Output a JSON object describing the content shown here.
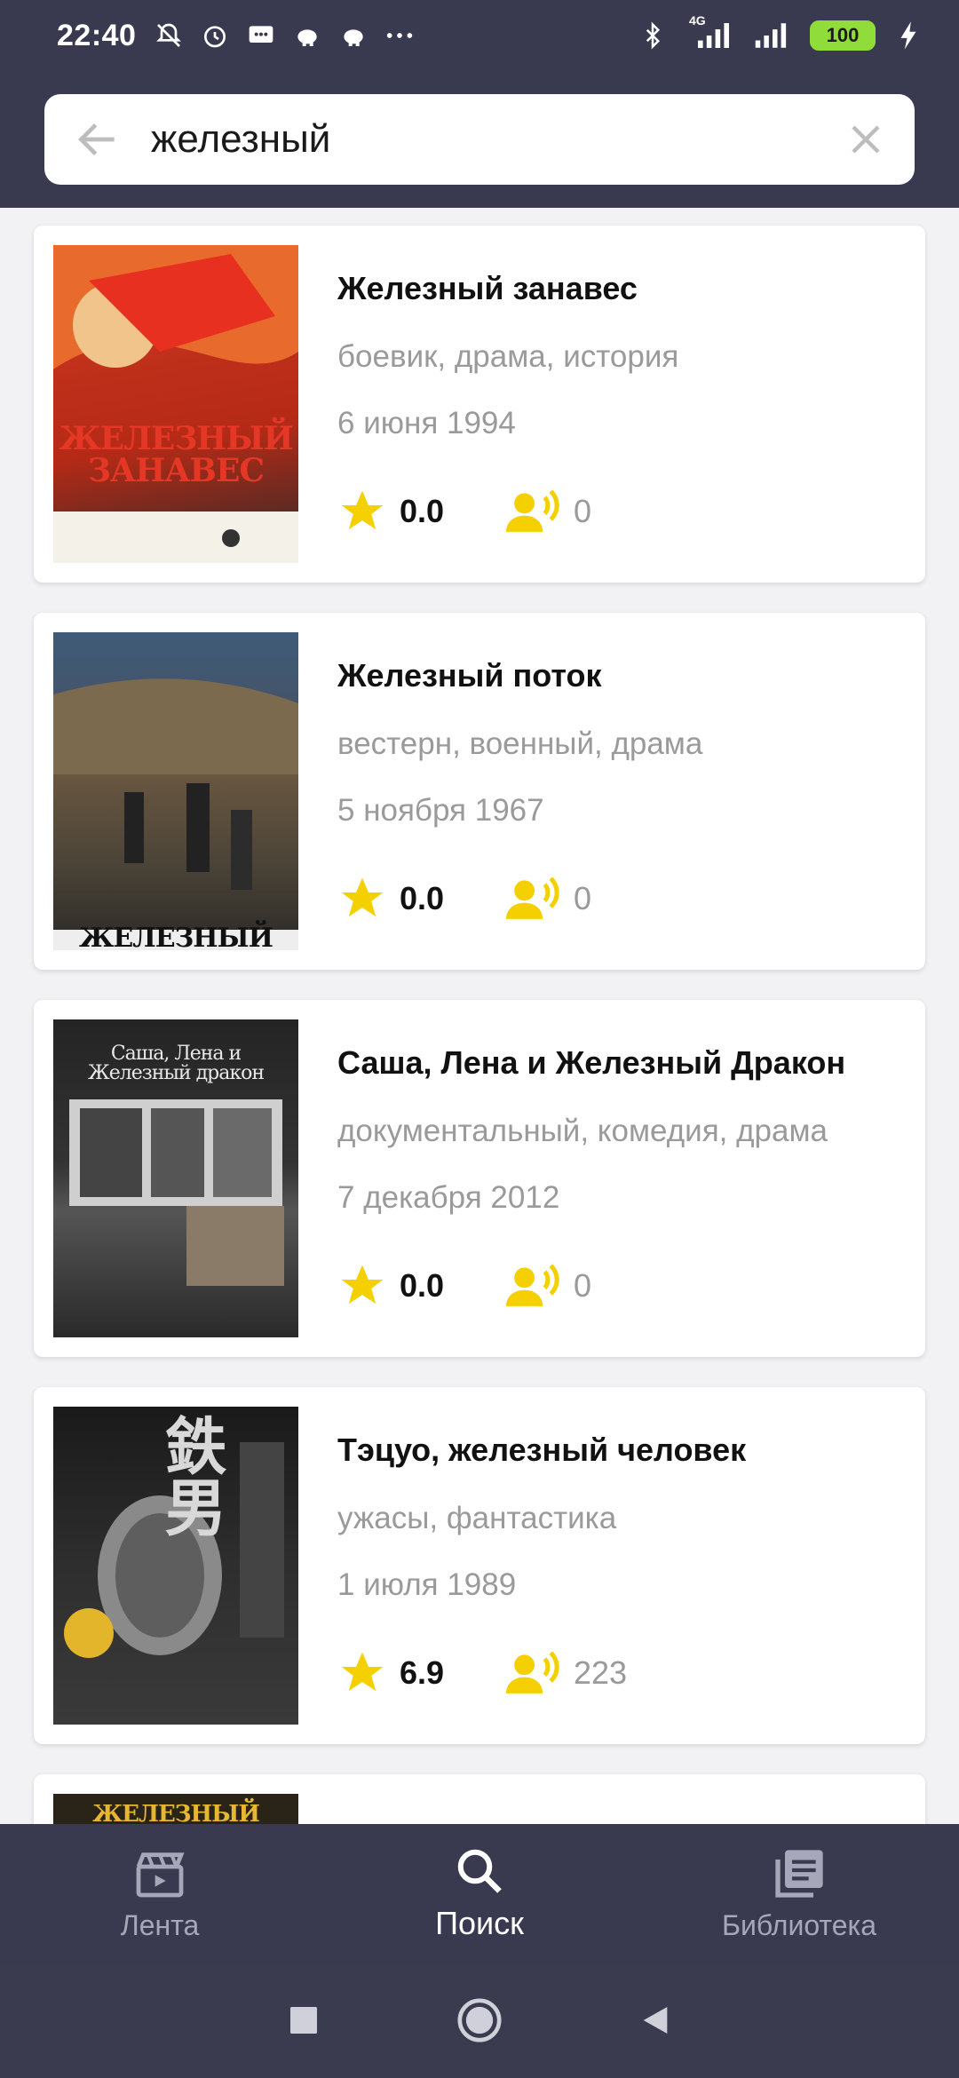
{
  "status_bar": {
    "time": "22:40",
    "battery": "100",
    "network": "4G"
  },
  "search": {
    "query": "железный",
    "placeholder": ""
  },
  "results": [
    {
      "title": "Железный занавес",
      "genres": "боевик, драма, история",
      "date": "6 июня 1994",
      "rating": "0.0",
      "votes": "0",
      "poster_caption": "ЖЕЛЕЗНЫЙ ЗАНАВЕС"
    },
    {
      "title": "Железный поток",
      "genres": "вестерн, военный, драма",
      "date": "5 ноября 1967",
      "rating": "0.0",
      "votes": "0",
      "poster_caption": "ЖЕЛЕЗНЫЙ ПОТОК"
    },
    {
      "title": "Саша, Лена и Железный Дракон",
      "genres": "документальный, комедия, драма",
      "date": "7 декабря 2012",
      "rating": "0.0",
      "votes": "0",
      "poster_caption": "Саша, Лена и Железный дракон"
    },
    {
      "title": "Тэцуо, железный человек",
      "genres": "ужасы, фантастика",
      "date": "1 июля 1989",
      "rating": "6.9",
      "votes": "223",
      "poster_caption": "鉄男"
    },
    {
      "title": "",
      "genres": "",
      "date": "",
      "rating": "",
      "votes": "",
      "poster_caption": "ЖЕЛЕЗНЫЙ ЧЕЛОВЕК"
    }
  ],
  "bottom_nav": {
    "feed": "Лента",
    "search": "Поиск",
    "library": "Библиотека",
    "active": "search"
  },
  "colors": {
    "header_bg": "#393a50",
    "star": "#f5d000",
    "muted_text": "#9a9a9a"
  }
}
